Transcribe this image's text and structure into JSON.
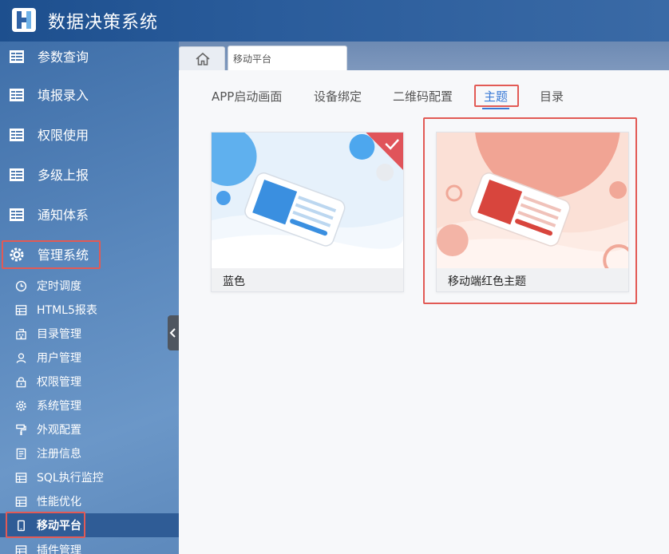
{
  "app": {
    "title": "数据决策系统"
  },
  "sidebar": {
    "main_items": [
      {
        "label": "参数查询"
      },
      {
        "label": "填报录入"
      },
      {
        "label": "权限使用"
      },
      {
        "label": "多级上报"
      },
      {
        "label": "通知体系"
      },
      {
        "label": "管理系统"
      }
    ],
    "sub_items": [
      {
        "label": "定时调度",
        "icon": "clock-icon"
      },
      {
        "label": "HTML5报表",
        "icon": "grid-report-icon"
      },
      {
        "label": "目录管理",
        "icon": "building-icon"
      },
      {
        "label": "用户管理",
        "icon": "user-icon"
      },
      {
        "label": "权限管理",
        "icon": "lock-icon"
      },
      {
        "label": "系统管理",
        "icon": "gear-icon"
      },
      {
        "label": "外观配置",
        "icon": "paint-roller-icon"
      },
      {
        "label": "注册信息",
        "icon": "document-icon"
      },
      {
        "label": "SQL执行监控",
        "icon": "grid-monitor-icon"
      },
      {
        "label": "性能优化",
        "icon": "grid-performance-icon"
      },
      {
        "label": "移动平台",
        "icon": "mobile-icon"
      },
      {
        "label": "插件管理",
        "icon": "grid-plugin-icon"
      }
    ]
  },
  "tabs": {
    "current_page": "移动平台"
  },
  "subtabs": [
    {
      "label": "APP启动画面"
    },
    {
      "label": "设备绑定"
    },
    {
      "label": "二维码配置"
    },
    {
      "label": "主题"
    },
    {
      "label": "目录"
    }
  ],
  "themes": [
    {
      "name": "蓝色",
      "selected": true
    },
    {
      "name": "移动端红色主题",
      "selected": false
    }
  ],
  "colors": {
    "accent": "#3a7ad6",
    "highlight": "#e25a55",
    "selected_check": "#e0545a"
  }
}
